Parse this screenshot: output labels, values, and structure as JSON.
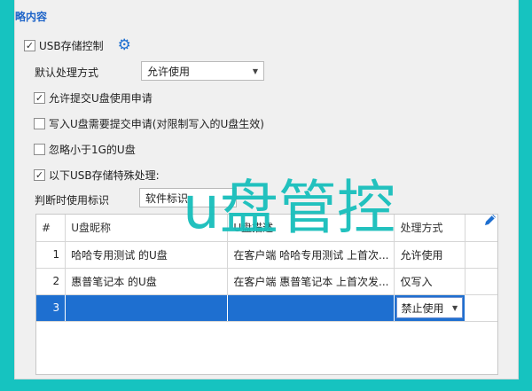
{
  "section_title": "略内容",
  "usb_control": {
    "label": "USB存储控制",
    "checked": true
  },
  "default_action": {
    "label": "默认处理方式",
    "value": "允许使用"
  },
  "options": [
    {
      "label": "允许提交U盘使用申请",
      "checked": true
    },
    {
      "label": "写入U盘需要提交申请(对限制写入的U盘生效)",
      "checked": false
    },
    {
      "label": "忽略小于1G的U盘",
      "checked": false
    },
    {
      "label": "以下USB存储特殊处理:",
      "checked": true
    }
  ],
  "identify": {
    "label": "判断时使用标识",
    "value": "软件标识"
  },
  "grid": {
    "headers": [
      "#",
      "U盘昵称",
      "U盘描述",
      "处理方式"
    ],
    "rows": [
      {
        "num": "1",
        "name": "哈哈专用测试 的U盘",
        "desc": "在客户端 哈哈专用测试 上首次...",
        "action": "允许使用"
      },
      {
        "num": "2",
        "name": "惠普笔记本 的U盘",
        "desc": "在客户端 惠普笔记本 上首次发...",
        "action": "仅写入"
      },
      {
        "num": "3",
        "name": "",
        "desc": "",
        "action": "禁止使用"
      }
    ]
  },
  "watermark": "u盘管控",
  "colors": {
    "background": "#16c3c0",
    "accent": "#1e6fd0",
    "title": "#1e64c8"
  },
  "icons": {
    "settings": "gear-icon",
    "edit": "pencil-icon"
  }
}
